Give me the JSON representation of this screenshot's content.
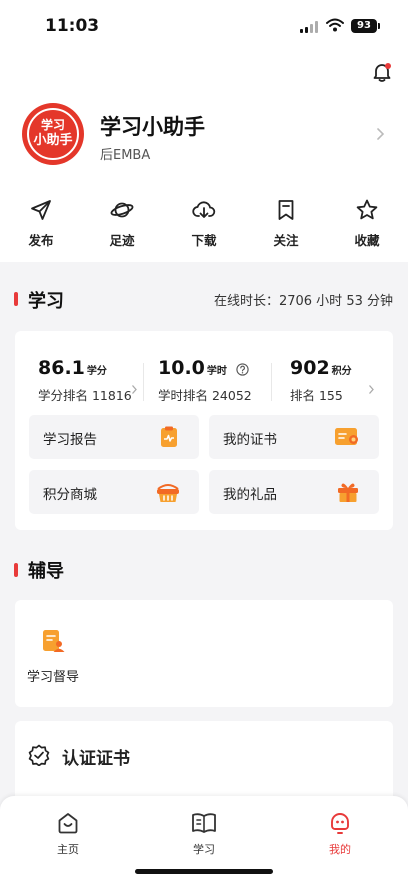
{
  "status_bar": {
    "time": "11:03",
    "battery": "93"
  },
  "profile": {
    "name": "学习小助手",
    "subtitle": "后EMBA",
    "avatar_line1": "学习",
    "avatar_line2": "小助手"
  },
  "quick_actions": [
    {
      "label": "发布",
      "icon": "send-icon"
    },
    {
      "label": "足迹",
      "icon": "planet-icon"
    },
    {
      "label": "下载",
      "icon": "download-icon"
    },
    {
      "label": "关注",
      "icon": "bookmark-icon"
    },
    {
      "label": "收藏",
      "icon": "star-icon"
    }
  ],
  "study": {
    "title": "学习",
    "online_label": "在线时长：",
    "online_value": "2706 小时 53 分钟",
    "stats": [
      {
        "value": "86.1",
        "unit": "学分",
        "rank": "学分排名 11816"
      },
      {
        "value": "10.0",
        "unit": "学时",
        "rank": "学时排名 24052"
      },
      {
        "value": "902",
        "unit": "积分",
        "rank": "排名 155"
      }
    ],
    "tiles": [
      {
        "label": "学习报告",
        "icon": "report-icon"
      },
      {
        "label": "我的证书",
        "icon": "certificate-icon"
      },
      {
        "label": "积分商城",
        "icon": "shop-basket-icon"
      },
      {
        "label": "我的礼品",
        "icon": "gift-icon"
      }
    ]
  },
  "tutoring": {
    "title": "辅导",
    "item_label": "学习督导"
  },
  "certification": {
    "title": "认证证书"
  },
  "tabbar": [
    {
      "label": "主页",
      "active": false
    },
    {
      "label": "学习",
      "active": false
    },
    {
      "label": "我的",
      "active": true
    }
  ],
  "colors": {
    "accent": "#e83a3a",
    "orange": "#f7a02f"
  }
}
